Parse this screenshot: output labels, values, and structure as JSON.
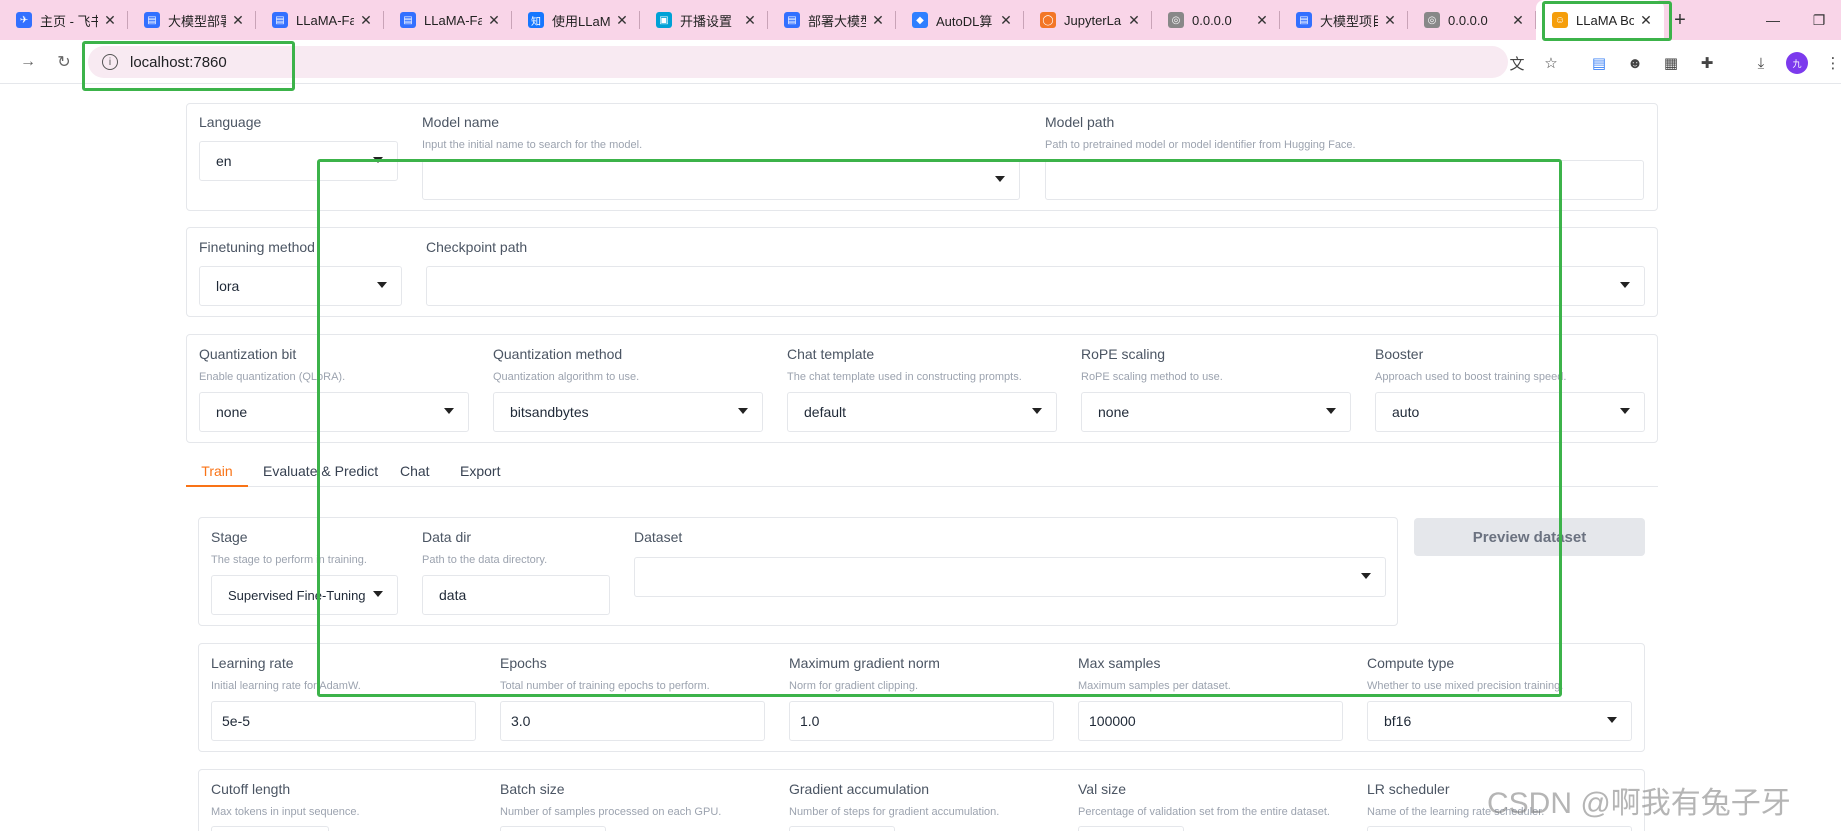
{
  "browser": {
    "tabs": [
      {
        "label": "主页 - 飞书",
        "color": "#3370ff",
        "glyph": "✈"
      },
      {
        "label": "大模型部署",
        "color": "#3370ff",
        "glyph": "▤"
      },
      {
        "label": "LLaMA-Fa",
        "color": "#3370ff",
        "glyph": "▤"
      },
      {
        "label": "LLaMA-Fa",
        "color": "#3370ff",
        "glyph": "▤"
      },
      {
        "label": "使用LLaMA",
        "color": "#1677ff",
        "glyph": "知"
      },
      {
        "label": "开播设置",
        "color": "#00a1d6",
        "glyph": "▣"
      },
      {
        "label": "部署大模型",
        "color": "#3370ff",
        "glyph": "▤"
      },
      {
        "label": "AutoDL算",
        "color": "#2f7fff",
        "glyph": "◆"
      },
      {
        "label": "JupyterLab",
        "color": "#f37626",
        "glyph": "◯"
      },
      {
        "label": "0.0.0.0",
        "color": "#888888",
        "glyph": "◎"
      },
      {
        "label": "大模型项目",
        "color": "#3370ff",
        "glyph": "▤"
      },
      {
        "label": "0.0.0.0",
        "color": "#888888",
        "glyph": "◎"
      },
      {
        "label": "LLaMA Bo",
        "color": "#f59e0b",
        "glyph": "☺"
      }
    ],
    "url": "localhost:7860"
  },
  "top": {
    "language": {
      "label": "Language",
      "value": "en"
    },
    "model_name": {
      "label": "Model name",
      "info": "Input the initial name to search for the model.",
      "value": ""
    },
    "model_path": {
      "label": "Model path",
      "info": "Path to pretrained model or model identifier from Hugging Face.",
      "value": ""
    }
  },
  "finetune": {
    "method": {
      "label": "Finetuning method",
      "value": "lora"
    },
    "checkpoint": {
      "label": "Checkpoint path",
      "value": ""
    }
  },
  "advanced": {
    "quant_bit": {
      "label": "Quantization bit",
      "info": "Enable quantization (QLoRA).",
      "value": "none"
    },
    "quant_method": {
      "label": "Quantization method",
      "info": "Quantization algorithm to use.",
      "value": "bitsandbytes"
    },
    "template": {
      "label": "Chat template",
      "info": "The chat template used in constructing prompts.",
      "value": "default"
    },
    "rope": {
      "label": "RoPE scaling",
      "info": "RoPE scaling method to use.",
      "value": "none"
    },
    "booster": {
      "label": "Booster",
      "info": "Approach used to boost training speed.",
      "value": "auto"
    }
  },
  "tabs": [
    "Train",
    "Evaluate & Predict",
    "Chat",
    "Export"
  ],
  "train": {
    "stage": {
      "label": "Stage",
      "info": "The stage to perform in training.",
      "value": "Supervised Fine-Tuning"
    },
    "data_dir": {
      "label": "Data dir",
      "info": "Path to the data directory.",
      "value": "data"
    },
    "dataset": {
      "label": "Dataset",
      "value": ""
    },
    "preview_button": "Preview dataset",
    "lr": {
      "label": "Learning rate",
      "info": "Initial learning rate for AdamW.",
      "value": "5e-5"
    },
    "epochs": {
      "label": "Epochs",
      "info": "Total number of training epochs to perform.",
      "value": "3.0"
    },
    "grad_norm": {
      "label": "Maximum gradient norm",
      "info": "Norm for gradient clipping.",
      "value": "1.0"
    },
    "max_samples": {
      "label": "Max samples",
      "info": "Maximum samples per dataset.",
      "value": "100000"
    },
    "compute": {
      "label": "Compute type",
      "info": "Whether to use mixed precision training.",
      "value": "bf16"
    },
    "cutoff": {
      "label": "Cutoff length",
      "info": "Max tokens in input sequence."
    },
    "batch": {
      "label": "Batch size",
      "info": "Number of samples processed on each GPU."
    },
    "grad_acc": {
      "label": "Gradient accumulation",
      "info": "Number of steps for gradient accumulation."
    },
    "val_size": {
      "label": "Val size",
      "info": "Percentage of validation set from the entire dataset."
    },
    "scheduler": {
      "label": "LR scheduler",
      "info": "Name of the learning rate scheduler."
    }
  },
  "watermark": "CSDN @啊我有兔子牙"
}
